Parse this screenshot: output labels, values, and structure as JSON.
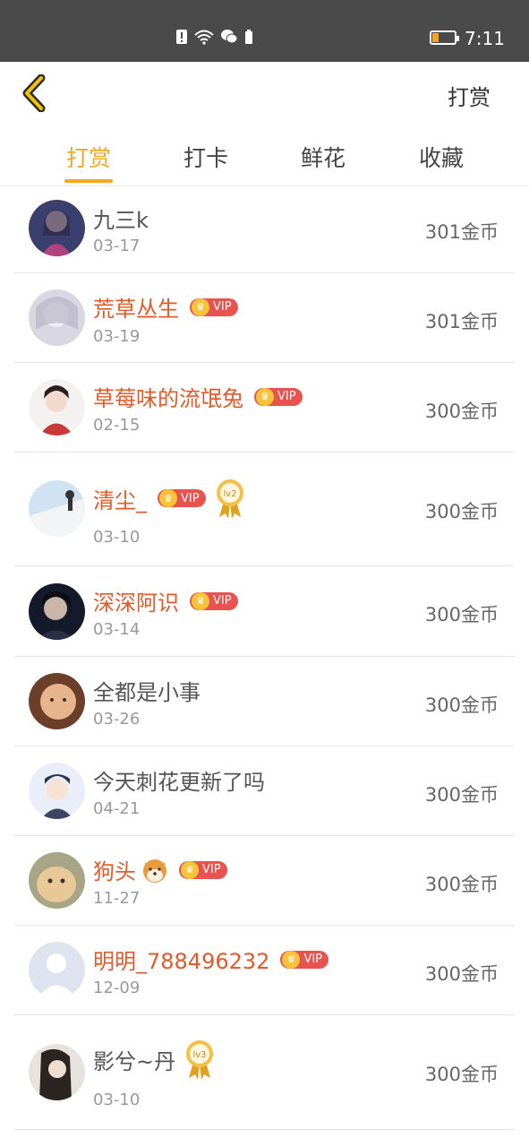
{
  "status_bar": {
    "time": "7:11"
  },
  "header": {
    "back_icon": "chevron-left-icon",
    "title": "打赏"
  },
  "tabs": [
    {
      "label": "打赏",
      "active": true
    },
    {
      "label": "打卡",
      "active": false
    },
    {
      "label": "鲜花",
      "active": false
    },
    {
      "label": "收藏",
      "active": false
    }
  ],
  "colors": {
    "accent": "#f5a623",
    "vip_name": "#e05a2a",
    "vip_badge": "#e8534f"
  },
  "rows": [
    {
      "name": "九三k",
      "date": "03-17",
      "coins": "301金币",
      "vip": false
    },
    {
      "name": "荒草丛生",
      "date": "03-19",
      "coins": "301金币",
      "vip": true,
      "vip_label": "VIP"
    },
    {
      "name": "草莓味的流氓兔",
      "date": "02-15",
      "coins": "300金币",
      "vip": true,
      "vip_label": "VIP"
    },
    {
      "name": "清尘_",
      "date": "03-10",
      "coins": "300金币",
      "vip": true,
      "vip_label": "VIP",
      "medal": "lv2"
    },
    {
      "name": "深深阿识",
      "date": "03-14",
      "coins": "300金币",
      "vip": true,
      "vip_label": "VIP"
    },
    {
      "name": "全都是小事",
      "date": "03-26",
      "coins": "300金币",
      "vip": false
    },
    {
      "name": "今天刺花更新了吗",
      "date": "04-21",
      "coins": "300金币",
      "vip": false
    },
    {
      "name": "狗头",
      "date": "11-27",
      "coins": "300金币",
      "vip": true,
      "vip_label": "VIP",
      "emoji": "dog-face-icon"
    },
    {
      "name": "明明_788496232",
      "date": "12-09",
      "coins": "300金币",
      "vip": true,
      "vip_label": "VIP"
    },
    {
      "name": "影兮~丹",
      "date": "03-10",
      "coins": "300金币",
      "vip": false,
      "medal": "lv3"
    }
  ]
}
